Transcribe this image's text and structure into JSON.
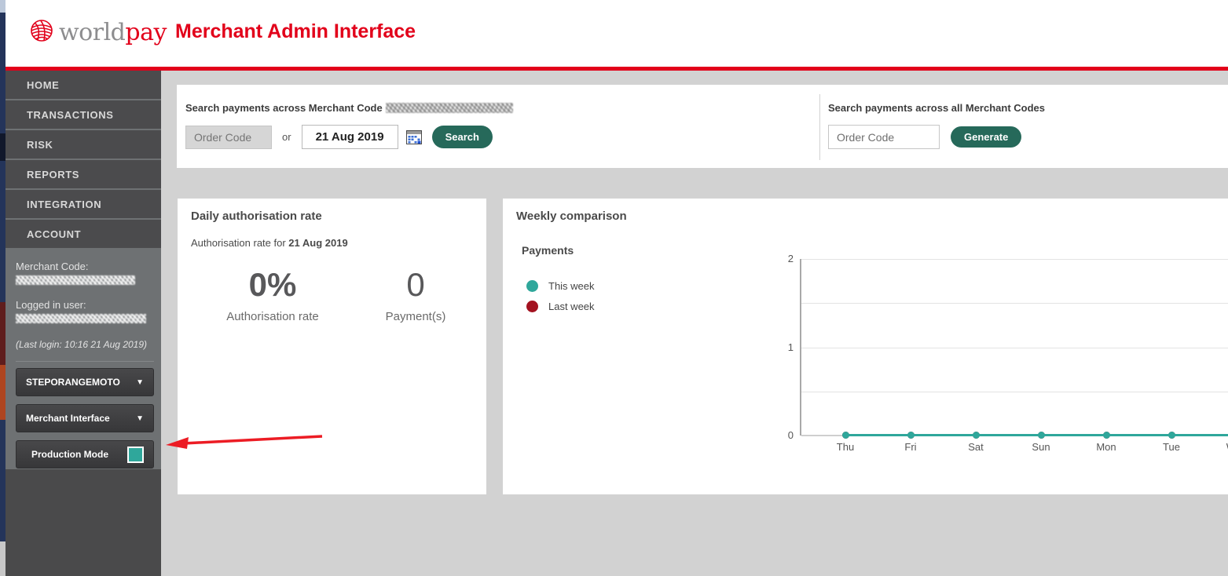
{
  "header": {
    "logo_world": "world",
    "logo_pay": "pay",
    "title": "Merchant Admin Interface"
  },
  "sidebar": {
    "nav": [
      {
        "label": "HOME"
      },
      {
        "label": "TRANSACTIONS"
      },
      {
        "label": "RISK"
      },
      {
        "label": "REPORTS"
      },
      {
        "label": "INTEGRATION"
      },
      {
        "label": "ACCOUNT"
      }
    ],
    "info": {
      "merchant_code_label": "Merchant Code:",
      "logged_in_label": "Logged in user:",
      "last_login": "(Last login: 10:16 21 Aug 2019)"
    },
    "selectors": {
      "merchant_select": "STEPORANGEMOTO",
      "interface_select": "Merchant Interface",
      "mode_label": "Production Mode"
    }
  },
  "search_panel": {
    "left": {
      "label": "Search payments across Merchant Code",
      "order_code_placeholder": "Order Code",
      "or_label": "or",
      "date_value": "21 Aug 2019",
      "search_button": "Search"
    },
    "right": {
      "label": "Search payments across all Merchant Codes",
      "order_code_placeholder": "Order Code",
      "generate_button": "Generate"
    }
  },
  "daily_card": {
    "title": "Daily authorisation rate",
    "subtitle_prefix": "Authorisation rate for ",
    "subtitle_date": "21 Aug 2019",
    "rate_value": "0%",
    "rate_label": "Authorisation rate",
    "payments_value": "0",
    "payments_label": "Payment(s)"
  },
  "weekly_card": {
    "title": "Weekly comparison",
    "subtitle": "Payments",
    "legend": [
      {
        "label": "This week",
        "color": "#2fa79b"
      },
      {
        "label": "Last week",
        "color": "#a31220"
      }
    ]
  },
  "chart_data": {
    "type": "line",
    "title": "Payments",
    "categories": [
      "Thu",
      "Fri",
      "Sat",
      "Sun",
      "Mon",
      "Tue",
      "Wed"
    ],
    "series": [
      {
        "name": "This week",
        "color": "#2fa79b",
        "values": [
          0,
          0,
          0,
          0,
          0,
          0,
          0
        ]
      },
      {
        "name": "Last week",
        "color": "#a31220",
        "values": [
          0,
          0,
          0,
          0,
          0,
          0,
          0
        ]
      }
    ],
    "xlabel": "",
    "ylabel": "",
    "ylim": [
      0,
      2
    ],
    "yticks": [
      0,
      1,
      2
    ],
    "grid": true,
    "gridstep": 0.5,
    "legend_position": "left"
  },
  "colors": {
    "accent_red": "#e2001a",
    "button_green": "#26695a",
    "teal": "#2fa79b",
    "legend_dark_red": "#a31220",
    "sidebar_item": "#4b4b4d",
    "sidebar_bg": "#6e7173",
    "page_bg": "#d2d2d2"
  }
}
